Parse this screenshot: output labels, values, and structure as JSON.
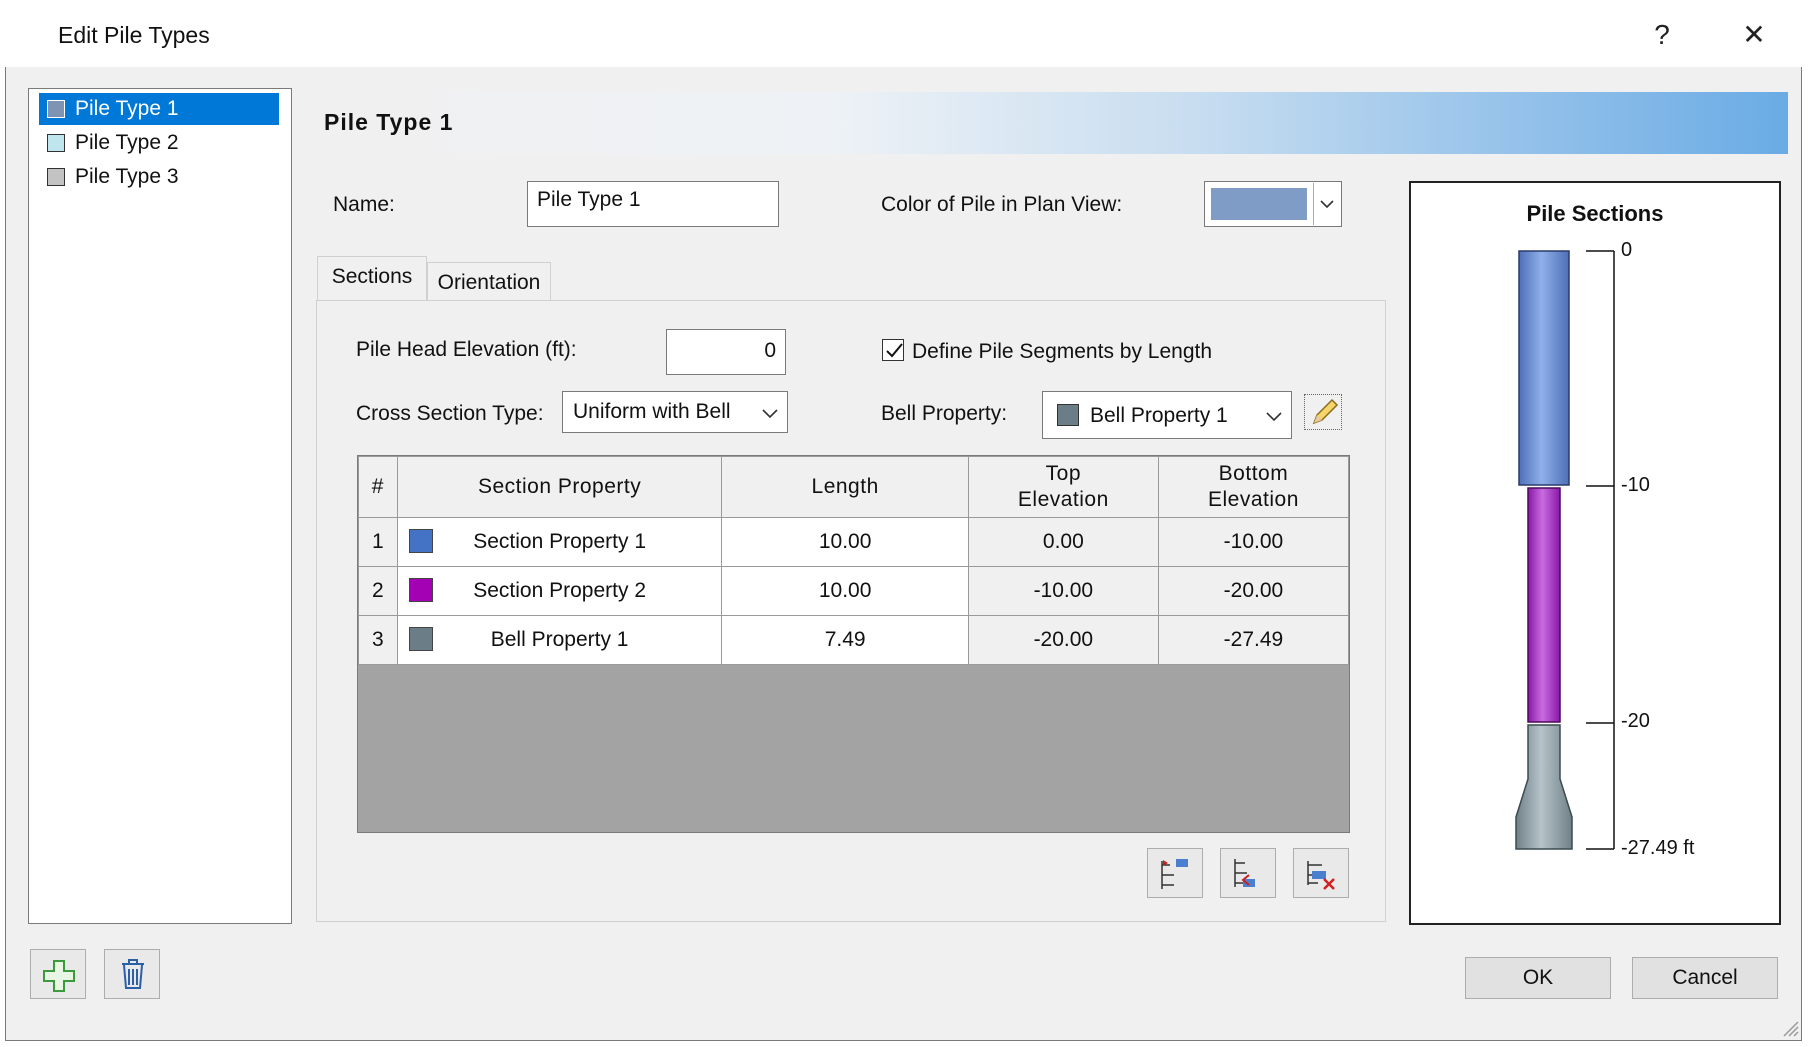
{
  "window": {
    "title": "Edit Pile Types",
    "help_label": "?",
    "close_label": "✕"
  },
  "pile_list": [
    {
      "label": "Pile Type 1",
      "color": "#7f93b3",
      "selected": true
    },
    {
      "label": "Pile Type 2",
      "color": "#bfe6ef",
      "selected": false
    },
    {
      "label": "Pile Type 3",
      "color": "#c3c3c3",
      "selected": false
    }
  ],
  "header": {
    "title": "Pile Type 1"
  },
  "form": {
    "name_label": "Name:",
    "name_value": "Pile Type 1",
    "plan_color_label": "Color of Pile in Plan View:",
    "plan_color": "#7f9cc7"
  },
  "tabs": [
    {
      "label": "Sections",
      "active": true
    },
    {
      "label": "Orientation",
      "active": false
    }
  ],
  "sections_tab": {
    "head_elev_label": "Pile Head Elevation (ft):",
    "head_elev_value": "0",
    "define_by_length_label": "Define Pile Segments by Length",
    "define_by_length_checked": true,
    "cross_section_label": "Cross Section Type:",
    "cross_section_value": "Uniform with Bell",
    "bell_property_label": "Bell Property:",
    "bell_property_value": "Bell Property 1",
    "bell_property_color": "#6b7d86"
  },
  "table": {
    "headers": [
      "#",
      "Section Property",
      "Length",
      "Top\nElevation",
      "Bottom\nElevation"
    ],
    "rows": [
      {
        "num": "1",
        "color": "#4472c4",
        "property": "Section Property 1",
        "length": "10.00",
        "top": "0.00",
        "bottom": "-10.00"
      },
      {
        "num": "2",
        "color": "#a400b4",
        "property": "Section Property 2",
        "length": "10.00",
        "top": "-10.00",
        "bottom": "-20.00"
      },
      {
        "num": "3",
        "color": "#6b7d86",
        "property": "Bell Property 1",
        "length": "7.49",
        "top": "-20.00",
        "bottom": "-27.49"
      }
    ]
  },
  "preview": {
    "title": "Pile Sections",
    "ticks": [
      "0",
      "-10",
      "-20",
      "-27.49 ft"
    ],
    "segment_colors": [
      "#5b82c8",
      "#a02cc0",
      "#8fa0a6"
    ]
  },
  "buttons": {
    "ok": "OK",
    "cancel": "Cancel"
  }
}
